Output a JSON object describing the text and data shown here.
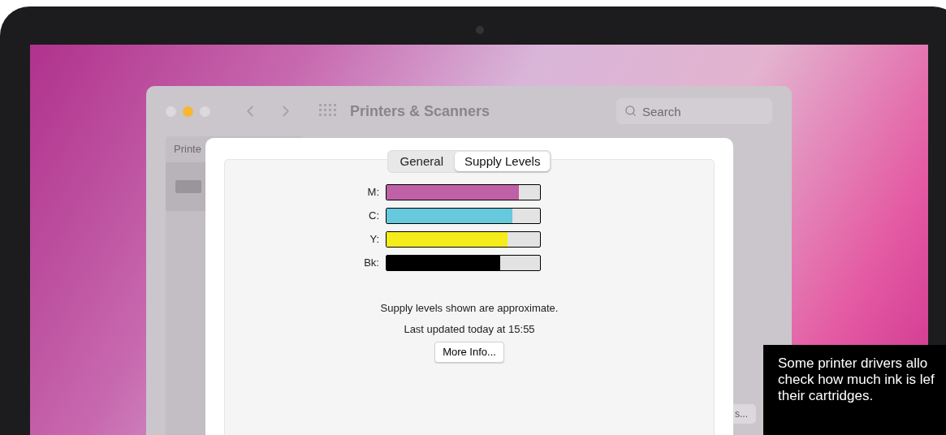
{
  "window": {
    "title": "Printers & Scanners",
    "search": {
      "placeholder": "Search"
    }
  },
  "sidebar": {
    "header": "Printe"
  },
  "background_button": "s...",
  "sheet": {
    "tabs": [
      {
        "label": "General",
        "selected": false
      },
      {
        "label": "Supply Levels",
        "selected": true
      }
    ],
    "supplies": [
      {
        "label": "M:",
        "level": 0.86,
        "color": "#c060a6"
      },
      {
        "label": "C:",
        "level": 0.82,
        "color": "#66c9dd"
      },
      {
        "label": "Y:",
        "level": 0.79,
        "color": "#f5ec1c"
      },
      {
        "label": "Bk:",
        "level": 0.74,
        "color": "#000000"
      }
    ],
    "note": "Supply levels shown are approximate.",
    "updated": "Last updated today at 15:55",
    "button": "More Info..."
  },
  "caption": {
    "lines": [
      "Some printer drivers allo",
      "check how much ink is lef",
      "their cartridges."
    ]
  }
}
